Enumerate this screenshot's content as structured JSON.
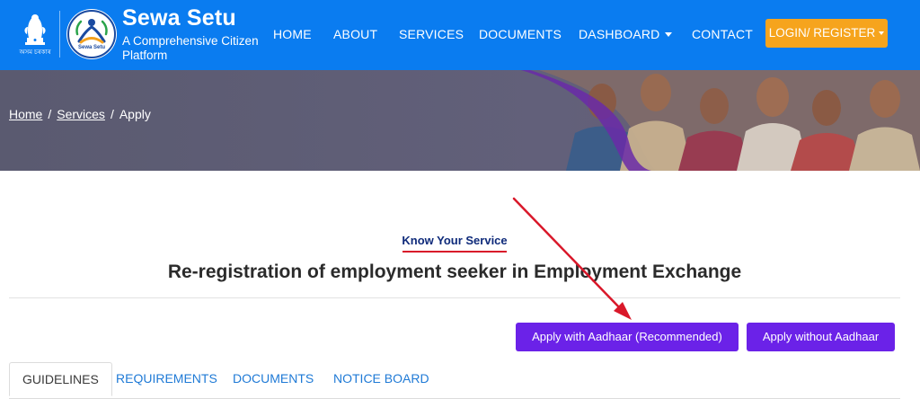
{
  "header": {
    "emblem_caption": "অসম চৰকাৰ",
    "logo_caption": "Sewa Setu",
    "brand_title": "Sewa Setu",
    "brand_tagline": "A Comprehensive Citizen Platform",
    "nav": [
      {
        "label": "HOME"
      },
      {
        "label": "ABOUT"
      },
      {
        "label": "SERVICES"
      },
      {
        "label": "DOCUMENTS"
      },
      {
        "label": "DASHBOARD",
        "has_dropdown": true
      },
      {
        "label": "CONTACT"
      }
    ],
    "login_label": "LOGIN/ REGISTER",
    "colors": {
      "bar": "#0a7cf0",
      "login": "#f6a41d"
    }
  },
  "breadcrumb": {
    "home": "Home",
    "services": "Services",
    "current": "Apply",
    "separator": "/"
  },
  "service": {
    "eyebrow": "Know Your Service",
    "title": "Re-registration of employment seeker in Employment Exchange"
  },
  "actions": {
    "apply_aadhaar": "Apply with Aadhaar (Recommended)",
    "apply_without_aadhaar": "Apply without Aadhaar",
    "button_color": "#6b22e8"
  },
  "tabs": [
    {
      "label": "GUIDELINES",
      "active": true
    },
    {
      "label": "REQUIREMENTS",
      "active": false
    },
    {
      "label": "DOCUMENTS",
      "active": false
    },
    {
      "label": "NOTICE BOARD",
      "active": false
    }
  ],
  "annotation": {
    "arrow_color": "#d9182a"
  }
}
